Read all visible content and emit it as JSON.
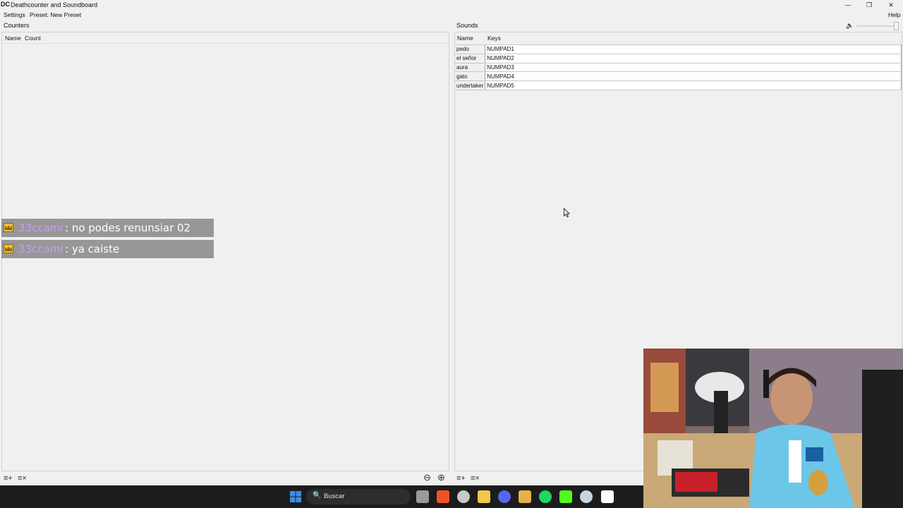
{
  "window": {
    "title": "Deathcounter and Soundboard",
    "app_icon_text": "DC",
    "minimize": "—",
    "restore": "❐",
    "close": "✕"
  },
  "menu": {
    "settings": "Settings",
    "preset": "Preset: New Preset",
    "help": "Help"
  },
  "counters": {
    "label": "Counters",
    "columns": {
      "name": "Name",
      "count": "Count"
    },
    "add_icon": "≡+",
    "remove_icon": "≡×",
    "zoom_out": "⊖",
    "zoom_in": "⊕"
  },
  "sounds": {
    "label": "Sounds",
    "columns": {
      "name": "Name",
      "keys": "Keys"
    },
    "rows": [
      {
        "name": "pedo",
        "key": "NUMPAD1"
      },
      {
        "name": "el señor",
        "key": "NUMPAD2"
      },
      {
        "name": "aura",
        "key": "NUMPAD3"
      },
      {
        "name": "gato",
        "key": "NUMPAD4"
      },
      {
        "name": "undertaker",
        "key": "NUMPAD5"
      }
    ],
    "volume_icon": "🔈",
    "volume_level": 0.95,
    "add_icon": "≡+",
    "remove_icon": "≡×"
  },
  "chat": [
    {
      "user": "33ccami",
      "message": ": no podes renunsiar 02"
    },
    {
      "user": "33ccami",
      "message": ": ya caiste"
    }
  ],
  "taskbar": {
    "search_placeholder": "Buscar",
    "search_icon": "🔍",
    "items": [
      {
        "name": "windows-start-icon",
        "color": "#3a8ee6"
      },
      {
        "name": "task-view-icon",
        "color": "#9a9a9a"
      },
      {
        "name": "brave-browser-icon",
        "color": "#f05323"
      },
      {
        "name": "obs-icon",
        "color": "#c8c8c8"
      },
      {
        "name": "file-explorer-icon",
        "color": "#f2c84b"
      },
      {
        "name": "discord-icon",
        "color": "#5865f2"
      },
      {
        "name": "files-app-icon",
        "color": "#e7b04a"
      },
      {
        "name": "spotify-icon",
        "color": "#1ed760"
      },
      {
        "name": "kick-icon",
        "color": "#53fc18"
      },
      {
        "name": "steam-icon",
        "color": "#c7d5e0"
      },
      {
        "name": "deathcounter-app-icon",
        "color": "#ffffff"
      }
    ]
  },
  "colors": {
    "chat_username": "#c69bf4",
    "chat_text": "#ffffff",
    "taskbar_bg": "#1c1c1c"
  }
}
